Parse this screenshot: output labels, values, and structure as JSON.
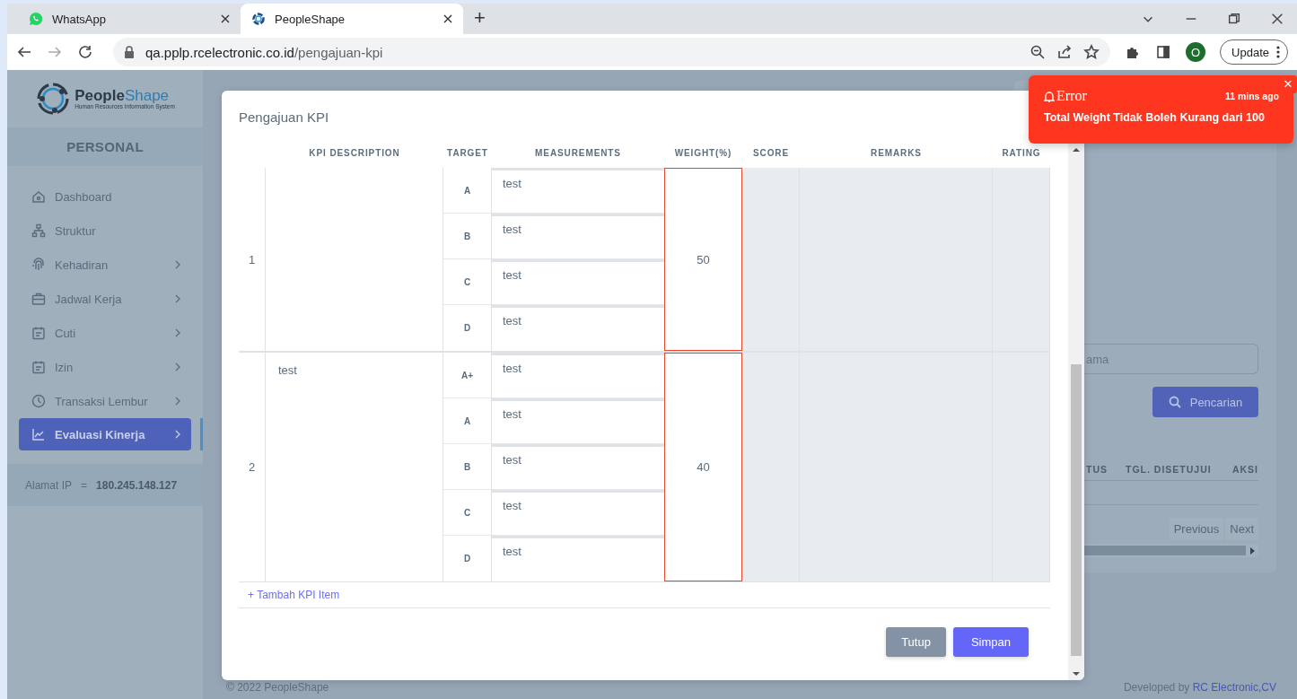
{
  "browser": {
    "tabs": [
      {
        "title": "WhatsApp",
        "selected": false
      },
      {
        "title": "PeopleShape",
        "selected": true
      }
    ],
    "new_tab": "+",
    "url_host": "qa.pplp.rcelectronic.co.id",
    "url_path": "/pengajuan-kpi",
    "profile_initial": "O",
    "update_label": "Update"
  },
  "sidebar": {
    "logo_name": "People",
    "logo_name_accent": "Shape",
    "logo_tagline": "Human Resources Information System",
    "section": "PERSONAL",
    "items": [
      {
        "label": "Dashboard",
        "submenu": false,
        "selected": false
      },
      {
        "label": "Struktur",
        "submenu": false,
        "selected": false
      },
      {
        "label": "Kehadiran",
        "submenu": true,
        "selected": false
      },
      {
        "label": "Jadwal Kerja",
        "submenu": true,
        "selected": false
      },
      {
        "label": "Cuti",
        "submenu": true,
        "selected": false
      },
      {
        "label": "Izin",
        "submenu": true,
        "selected": false
      },
      {
        "label": "Transaksi Lembur",
        "submenu": true,
        "selected": false
      },
      {
        "label": "Evaluasi Kinerja",
        "submenu": true,
        "selected": true
      }
    ],
    "ip_label": "Alamat IP",
    "ip_separator": "=",
    "ip_value": "180.245.148.127"
  },
  "page": {
    "search_placeholder": "ama",
    "search_button": "Pencarian",
    "columns": [
      "TUS",
      "TGL. DISETUJUI",
      "AKSI"
    ],
    "pagination": [
      "Previous",
      "Next"
    ]
  },
  "footer": {
    "copyright": "© 2022 PeopleShape",
    "developed_by": "Developed by",
    "company": "RC Electronic,CV"
  },
  "modal": {
    "title": "Pengajuan KPI",
    "columns": [
      "KPI DESCRIPTION",
      "TARGET",
      "MEASUREMENTS",
      "WEIGHT(%)",
      "SCORE",
      "REMARKS",
      "RATING"
    ],
    "rows": [
      {
        "number": "1",
        "targets": [
          {
            "grade": "A",
            "measurement": "test"
          },
          {
            "grade": "B",
            "measurement": "test"
          },
          {
            "grade": "C",
            "measurement": "test"
          },
          {
            "grade": "D",
            "measurement": "test"
          }
        ],
        "weight": "50",
        "weight_invalid": true
      },
      {
        "number": "2",
        "description": "test",
        "targets": [
          {
            "grade": "A+",
            "measurement": "test"
          },
          {
            "grade": "A",
            "measurement": "test"
          },
          {
            "grade": "B",
            "measurement": "test"
          },
          {
            "grade": "C",
            "measurement": "test"
          },
          {
            "grade": "D",
            "measurement": "test"
          }
        ],
        "weight": "40",
        "weight_invalid": true
      }
    ],
    "add_link": "+ Tambah KPI Item",
    "buttons": [
      {
        "label": "Tutup",
        "kind": "secondary"
      },
      {
        "label": "Simpan",
        "kind": "primary"
      }
    ]
  },
  "toast": {
    "title": "Error",
    "time": "11 mins ago",
    "message": "Total Weight Tidak Boleh Kurang dari 100",
    "close": "×"
  }
}
